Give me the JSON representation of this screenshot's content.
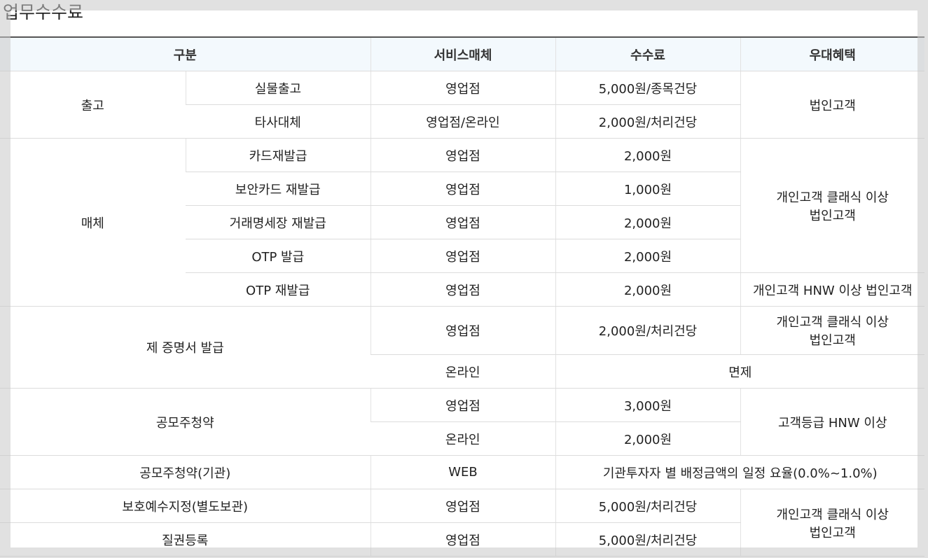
{
  "page_title": "업무수수료",
  "table": {
    "headers": {
      "category": "구분",
      "service": "서비스매체",
      "fee": "수수료",
      "benefit": "우대혜택"
    },
    "rows": {
      "chulgo": {
        "group": "출고",
        "items": [
          {
            "name": "실물출고",
            "service": "영업점",
            "fee": "5,000원/종목건당"
          },
          {
            "name": "타사대체",
            "service": "영업점/온라인",
            "fee": "2,000원/처리건당"
          }
        ],
        "benefit": "법인고객"
      },
      "maeche": {
        "group": "매체",
        "items": [
          {
            "name": "카드재발급",
            "service": "영업점",
            "fee": "2,000원"
          },
          {
            "name": "보안카드 재발급",
            "service": "영업점",
            "fee": "1,000원"
          },
          {
            "name": "거래명세장 재발급",
            "service": "영업점",
            "fee": "2,000원"
          },
          {
            "name": "OTP 발급",
            "service": "영업점",
            "fee": "2,000원"
          },
          {
            "name": "OTP 재발급",
            "service": "영업점",
            "fee": "2,000원"
          }
        ],
        "benefit_1": "개인고객 클래식 이상",
        "benefit_2": "법인고객",
        "benefit_otp": "개인고객 HNW 이상 법인고객"
      },
      "certificate": {
        "name": "제 증명서 발급",
        "service_1": "영업점",
        "fee_1": "2,000원/처리건당",
        "benefit_1a": "개인고객 클래식 이상",
        "benefit_1b": "법인고객",
        "service_2": "온라인",
        "fee_2": "면제"
      },
      "ipo": {
        "name": "공모주청약",
        "service_1": "영업점",
        "fee_1": "3,000원",
        "service_2": "온라인",
        "fee_2": "2,000원",
        "benefit": "고객등급 HNW 이상"
      },
      "ipo_inst": {
        "name": "공모주청약(기관)",
        "service": "WEB",
        "fee": "기관투자자 별 배정금액의 일정 요율(0.0%~1.0%)"
      },
      "deposit": {
        "name": "보호예수지정(별도보관)",
        "service": "영업점",
        "fee": "5,000원/처리건당",
        "benefit_a": "개인고객 클래식 이상",
        "benefit_b": "법인고객"
      },
      "pledge": {
        "name": "질권등록",
        "service": "영업점",
        "fee": "5,000원/처리건당"
      }
    }
  }
}
